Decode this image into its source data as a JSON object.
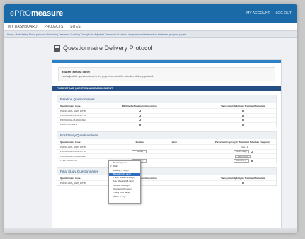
{
  "header": {
    "brand_prefix": "ePRO",
    "brand_suffix": "measure",
    "links": [
      "MY ACCOUNT",
      "LOG OUT"
    ]
  },
  "nav": {
    "items": [
      "MY DASHBOARD",
      "PROJECTS",
      "SITES"
    ]
  },
  "breadcrumb": "Home › Ambulatory Blood pressure Monitoring Treatment Tracking Through the Adjusted Treatment of Asthma diagnosis and Intervention treatment program project",
  "page": {
    "title": "Questionnaire Delivery Protocol"
  },
  "alert": {
    "title": "You are almost done!",
    "text": "Last adjust the questionnaires to the project norms of the standard delivery protocol."
  },
  "section_title": "PROJECT AND QUESTIONNAIRE ASSIGNMENT",
  "groups": [
    {
      "title": "Baseline Questionnaires",
      "columns": [
        "Questionnaire Code",
        "Multimedia Treatment Intervention",
        "",
        "Paroxysmal Hydrolysis Treatment Schedule"
      ],
      "rows": [
        {
          "code": "PERSC-ERA_DISP_INT(B)",
          "mid": false,
          "right": false
        },
        {
          "code": "PROSOCIAL-PROP-R-7-C",
          "mid": false,
          "right": false
        },
        {
          "code": "PROSOCIAL-PLAN-R-SEC",
          "mid": false,
          "right": false
        },
        {
          "code": "LEAD-CTV-NI-V-1",
          "mid": true,
          "right": true
        }
      ]
    },
    {
      "title": "Post Study Questionnaires",
      "columns": [
        "Questionnaire Code",
        "Multime",
        "ation",
        "Paroxysmal Hydrolysis Treatment Schedule Frequency"
      ],
      "rows": [
        {
          "code": "PERSC-ERA_DISP_INT(B)",
          "select": "",
          "freq": "Once"
        },
        {
          "code": "PROSOCIAL-PROP-R-7-C",
          "select": "Delivery",
          "freq": "Within 5 days"
        },
        {
          "code": "PROSOCIAL-PLAN-R-SEC",
          "select": "",
          "freq": "Every 4 days"
        },
        {
          "code": "LEAD-CTV-NI-V-1",
          "select": "Delivery",
          "freq": "Within 5 days"
        }
      ]
    },
    {
      "title": "Final Study Questionnaires",
      "columns": [
        "Questionnaire Code",
        "Multimedia Treatment Intervention",
        "",
        "Paroxysmal Hydrolysis Treatment Schedule"
      ],
      "rows": [
        {
          "code": "PERSC-ERA_DISP_INT(B)",
          "mid": false,
          "right": false
        }
      ]
    }
  ],
  "dropdown": {
    "items": [
      "Not assigned",
      "Daily",
      "Weekly (7 days)",
      "Biweekly (14 days)",
      "Three Weeks (21 days)",
      "Four Weeks (28 days)",
      "Monthly (30 days)",
      "Quarterly (90 days)",
      "Yearly (365 days)",
      "Within 5 days"
    ],
    "checked_index": 1,
    "selected_index": 3
  },
  "colors": {
    "header_bg": "#1b6aa8",
    "section_bar": "#264f86",
    "accent_stripe": "#2f7fc4",
    "selected_item": "#2f6fc0"
  }
}
